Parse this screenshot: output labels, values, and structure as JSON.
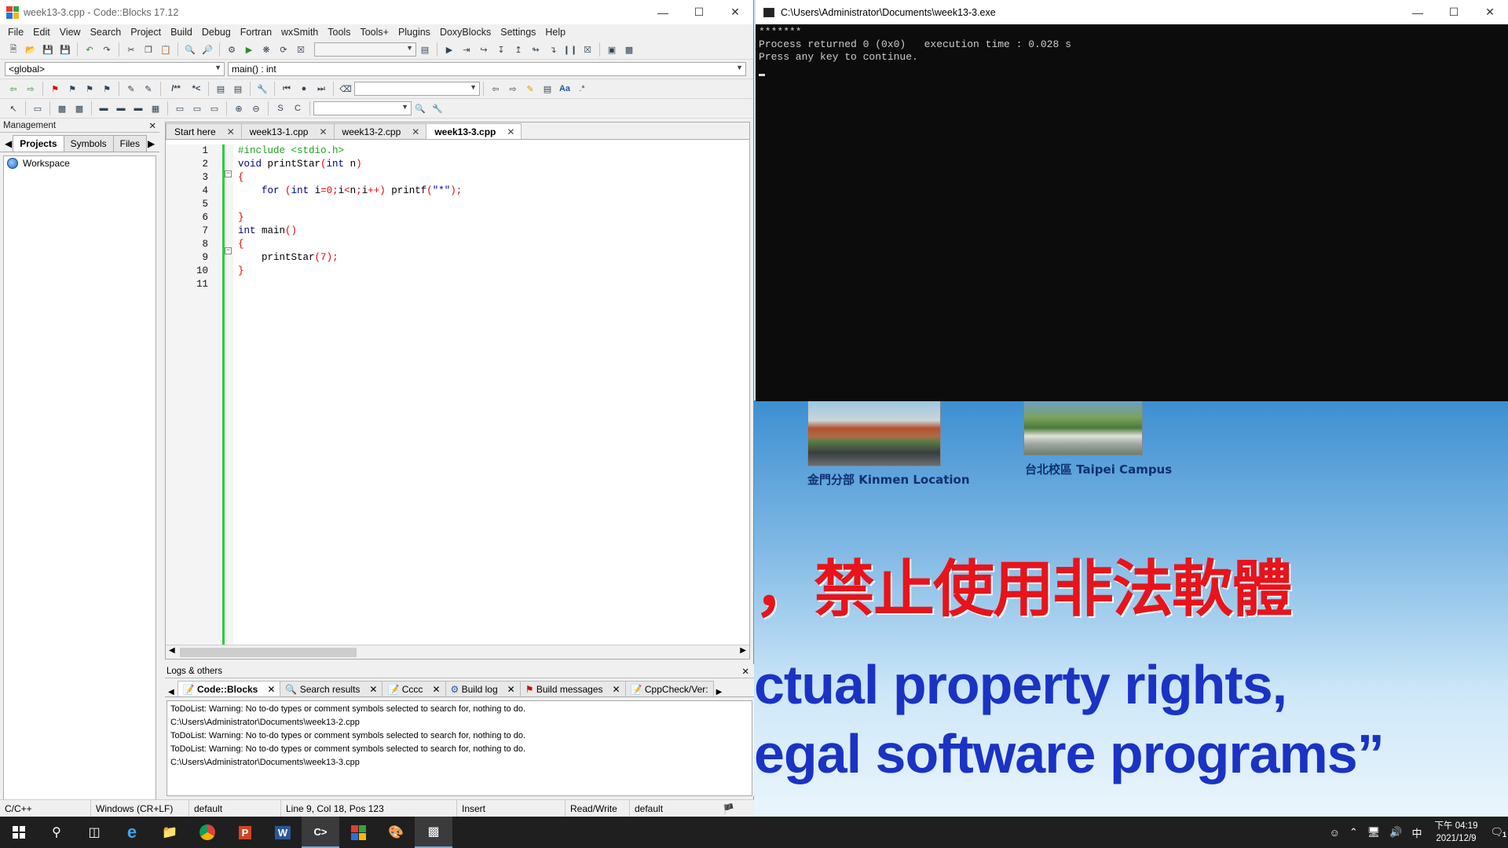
{
  "codeblocks": {
    "title": "week13-3.cpp - Code::Blocks 17.12",
    "menu": [
      "File",
      "Edit",
      "View",
      "Search",
      "Project",
      "Build",
      "Debug",
      "Fortran",
      "wxSmith",
      "Tools",
      "Tools+",
      "Plugins",
      "DoxyBlocks",
      "Settings",
      "Help"
    ],
    "scope_combo": "<global>",
    "function_combo": "main() : int",
    "doxy_labels": {
      "block": "/**",
      "line": "*<"
    },
    "management": {
      "header": "Management",
      "tabs": [
        "Projects",
        "Symbols",
        "Files"
      ],
      "active_tab": "Projects",
      "tree_root": "Workspace"
    },
    "editor": {
      "tabs": [
        {
          "label": "Start here",
          "active": false
        },
        {
          "label": "week13-1.cpp",
          "active": false
        },
        {
          "label": "week13-2.cpp",
          "active": false
        },
        {
          "label": "week13-3.cpp",
          "active": true
        }
      ],
      "line_numbers": [
        "1",
        "2",
        "3",
        "4",
        "5",
        "6",
        "7",
        "8",
        "9",
        "10",
        "11"
      ]
    },
    "logs": {
      "header": "Logs & others",
      "tabs": [
        {
          "label": "Code::Blocks",
          "active": true
        },
        {
          "label": "Search results",
          "active": false
        },
        {
          "label": "Cccc",
          "active": false
        },
        {
          "label": "Build log",
          "active": false
        },
        {
          "label": "Build messages",
          "active": false
        },
        {
          "label": "CppCheck/Ver:",
          "active": false
        }
      ],
      "lines": [
        "ToDoList: Warning: No to-do types or comment symbols selected to search for, nothing to do.",
        "C:\\Users\\Administrator\\Documents\\week13-2.cpp",
        "ToDoList: Warning: No to-do types or comment symbols selected to search for, nothing to do.",
        "ToDoList: Warning: No to-do types or comment symbols selected to search for, nothing to do.",
        "C:\\Users\\Administrator\\Documents\\week13-3.cpp"
      ]
    },
    "status": {
      "language": "C/C++",
      "eol": "Windows (CR+LF)",
      "encoding": "default",
      "position": "Line 9, Col 18, Pos 123",
      "mode": "Insert",
      "access": "Read/Write",
      "profile": "default"
    }
  },
  "console": {
    "title": "C:\\Users\\Administrator\\Documents\\week13-3.exe",
    "lines": [
      "*******",
      "Process returned 0 (0x0)   execution time : 0.028 s",
      "Press any key to continue."
    ]
  },
  "wallpaper": {
    "caption_kinmen": "金門分部 Kinmen Location",
    "caption_taipei": "台北校區 Taipei Campus",
    "banner_red": "，禁止使用非法軟體",
    "banner_blue_1": "ctual property rights,",
    "banner_blue_2": "egal software programs”"
  },
  "taskbar": {
    "clock_time": "下午 04:19",
    "clock_date": "2021/12/9",
    "ime": "中",
    "notifications": "1"
  },
  "colors": {
    "gutter_change_bar": "#2ecc40",
    "console_bg": "#0c0c0c",
    "banner_red": "#e8131b",
    "banner_blue": "#1a33c4"
  }
}
